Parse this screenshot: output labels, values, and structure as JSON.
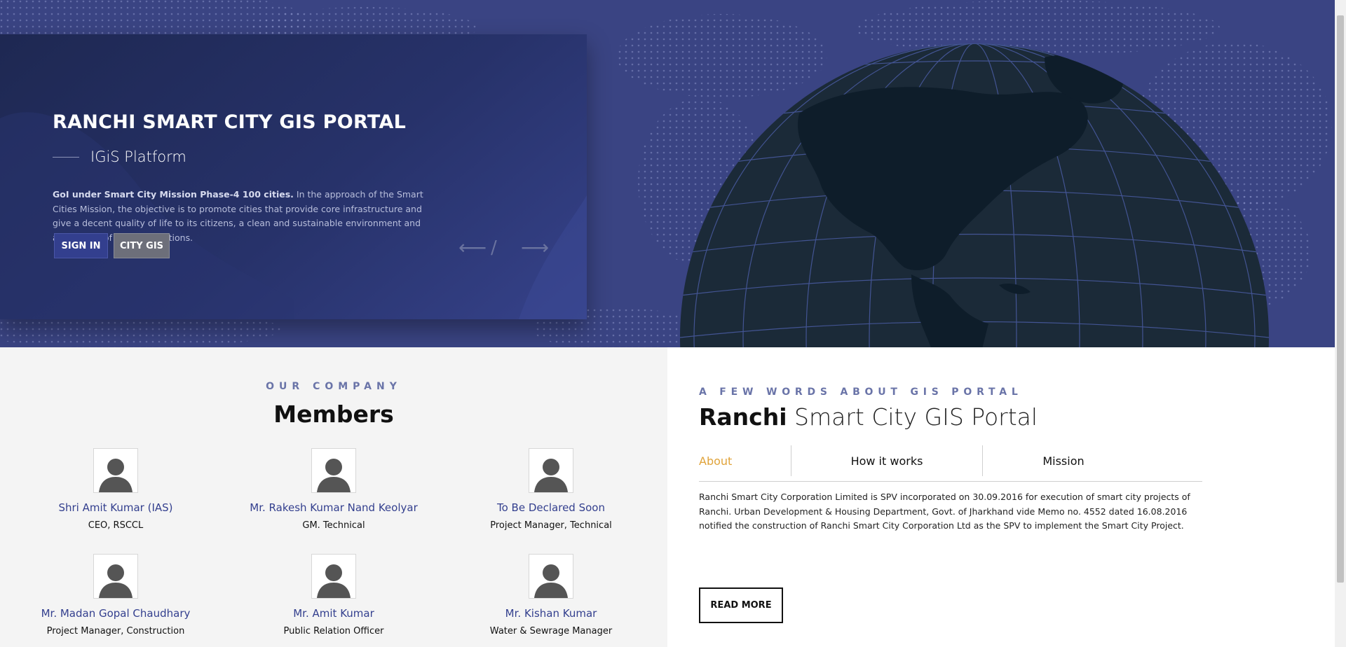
{
  "hero": {
    "title": "RANCHI SMART CITY GIS PORTAL",
    "subtitle": "IGiS Platform",
    "description_bold": "GoI under Smart City Mission Phase-4 100 cities.",
    "description_rest": " In the approach of the Smart Cities Mission, the objective is to promote cities that provide core infrastructure and give a decent quality of life to its citizens, a clean and sustainable environment and application of ‘Smart’ Solutions.",
    "signin_label": "SIGN IN",
    "citygis_label": "CITY GIS",
    "prev_arrow": "⟵",
    "separator": "/",
    "next_arrow": "⟶"
  },
  "members": {
    "kicker": "OUR COMPANY",
    "title": "Members",
    "items": [
      {
        "name": "Shri Amit Kumar (IAS)",
        "role": "CEO, RSCCL"
      },
      {
        "name": "Mr. Rakesh Kumar Nand Keolyar",
        "role": "GM. Technical"
      },
      {
        "name": "To Be Declared Soon",
        "role": "Project Manager, Technical"
      },
      {
        "name": "Mr. Madan Gopal Chaudhary",
        "role": "Project Manager, Construction"
      },
      {
        "name": "Mr. Amit Kumar",
        "role": "Public Relation Officer"
      },
      {
        "name": "Mr. Kishan Kumar",
        "role": "Water & Sewrage Manager"
      }
    ]
  },
  "about": {
    "kicker": "A FEW WORDS ABOUT GIS PORTAL",
    "title_bold": "Ranchi",
    "title_light": " Smart City GIS Portal",
    "tabs": [
      {
        "label": "About",
        "active": true
      },
      {
        "label": "How it works",
        "active": false
      },
      {
        "label": "Mission",
        "active": false
      }
    ],
    "text": "Ranchi Smart City Corporation Limited is SPV incorporated on 30.09.2016 for execution of smart city projects of Ranchi. Urban Development & Housing Department, Govt. of Jharkhand vide Memo no. 4552 dated 16.08.2016 notified the construction of Ranchi Smart City Corporation Ltd as the SPV to implement the Smart City Project.",
    "readmore_label": "READ MORE"
  },
  "colors": {
    "hero_bg": "#3a4483",
    "card_bg": "#1e2852",
    "accent_blue": "#333f8e",
    "tab_active": "#e0a33a"
  }
}
